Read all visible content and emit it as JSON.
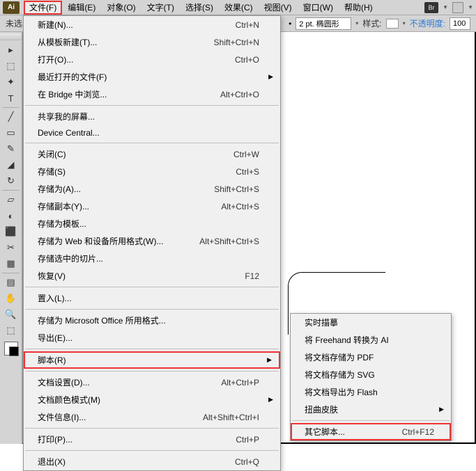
{
  "app_icon": "Ai",
  "menubar": {
    "items": [
      "文件(F)",
      "编辑(E)",
      "对象(O)",
      "文字(T)",
      "选择(S)",
      "效果(C)",
      "视图(V)",
      "窗口(W)",
      "帮助(H)"
    ],
    "br": "Br"
  },
  "toolbar": {
    "left_text": "未选",
    "stroke_value": "2 pt. 椭圆形",
    "style_label": "样式:",
    "opacity_label": "不透明度:",
    "opacity_value": "100"
  },
  "tools": {
    "row": [
      "▸",
      "⬚",
      "✦",
      "T",
      "╱",
      "▭",
      "✎",
      "◢",
      "↻",
      "▱",
      "◐",
      "⬛",
      "✂",
      "▦",
      "▤",
      "✋",
      "🔍",
      "⬚"
    ]
  },
  "file_menu": [
    {
      "label": "新建(N)...",
      "shortcut": "Ctrl+N"
    },
    {
      "label": "从模板新建(T)...",
      "shortcut": "Shift+Ctrl+N"
    },
    {
      "label": "打开(O)...",
      "shortcut": "Ctrl+O"
    },
    {
      "label": "最近打开的文件(F)",
      "arrow": true
    },
    {
      "label": "在 Bridge 中浏览...",
      "shortcut": "Alt+Ctrl+O"
    },
    {
      "sep": true
    },
    {
      "label": "共享我的屏幕..."
    },
    {
      "label": "Device Central..."
    },
    {
      "sep": true
    },
    {
      "label": "关闭(C)",
      "shortcut": "Ctrl+W"
    },
    {
      "label": "存储(S)",
      "shortcut": "Ctrl+S"
    },
    {
      "label": "存储为(A)...",
      "shortcut": "Shift+Ctrl+S"
    },
    {
      "label": "存储副本(Y)...",
      "shortcut": "Alt+Ctrl+S"
    },
    {
      "label": "存储为模板..."
    },
    {
      "label": "存储为 Web 和设备所用格式(W)...",
      "shortcut": "Alt+Shift+Ctrl+S"
    },
    {
      "label": "存储选中的切片..."
    },
    {
      "label": "恢复(V)",
      "shortcut": "F12"
    },
    {
      "sep": true
    },
    {
      "label": "置入(L)..."
    },
    {
      "sep": true
    },
    {
      "label": "存储为 Microsoft Office 所用格式..."
    },
    {
      "label": "导出(E)..."
    },
    {
      "sep": true
    },
    {
      "label": "脚本(R)",
      "arrow": true,
      "hl": true
    },
    {
      "sep": true
    },
    {
      "label": "文档设置(D)...",
      "shortcut": "Alt+Ctrl+P"
    },
    {
      "label": "文档颜色模式(M)",
      "arrow": true
    },
    {
      "label": "文件信息(I)...",
      "shortcut": "Alt+Shift+Ctrl+I"
    },
    {
      "sep": true
    },
    {
      "label": "打印(P)...",
      "shortcut": "Ctrl+P"
    },
    {
      "sep": true
    },
    {
      "label": "退出(X)",
      "shortcut": "Ctrl+Q"
    }
  ],
  "script_submenu": [
    {
      "label": "实时描摹"
    },
    {
      "label": "将 Freehand 转换为 AI"
    },
    {
      "label": "将文档存储为 PDF"
    },
    {
      "label": "将文档存储为 SVG"
    },
    {
      "label": "将文档导出为 Flash"
    },
    {
      "label": "扭曲皮肤",
      "arrow": true
    },
    {
      "sep": true
    },
    {
      "label": "其它脚本...",
      "shortcut": "Ctrl+F12",
      "hl": true
    }
  ]
}
